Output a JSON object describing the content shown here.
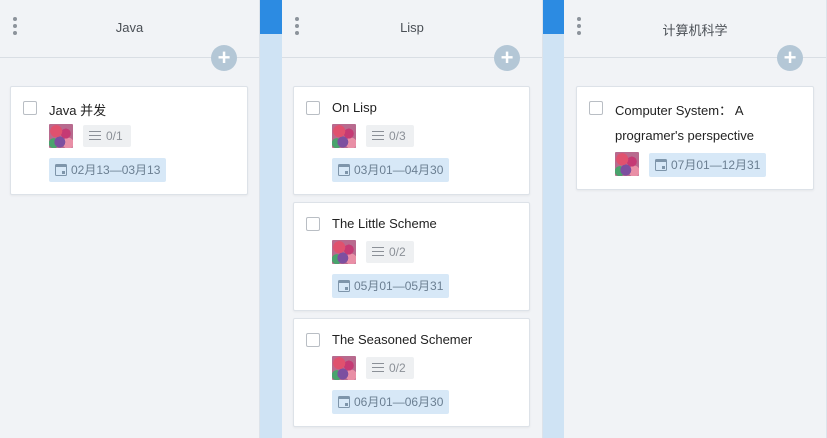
{
  "columns": [
    {
      "title": "Java",
      "cards": [
        {
          "title": "Java 并发",
          "checklist": "0/1",
          "date": "02月13—03月13"
        }
      ]
    },
    {
      "title": "Lisp",
      "cards": [
        {
          "title": "On Lisp",
          "checklist": "0/3",
          "date": "03月01—04月30"
        },
        {
          "title": "The Little Scheme",
          "checklist": "0/2",
          "date": "05月01—05月31"
        },
        {
          "title": "The Seasoned Schemer",
          "checklist": "0/2",
          "date": "06月01—06月30"
        }
      ]
    },
    {
      "title": "计算机科学",
      "cards": [
        {
          "title_line1": "Computer System：  A",
          "title_line2": "programer's perspective",
          "date": "07月01—12月31"
        }
      ]
    }
  ],
  "icons": {
    "column_menu": "more-vertical-icon",
    "add": "plus-icon",
    "checklist": "list-icon",
    "date": "calendar-icon"
  },
  "colors": {
    "board_background": "#cfe3f4",
    "accent_strip": "#2c8be2",
    "column_background": "#f1f3f6",
    "add_button": "#b4c7d6",
    "date_badge": "#d7e8f7"
  }
}
